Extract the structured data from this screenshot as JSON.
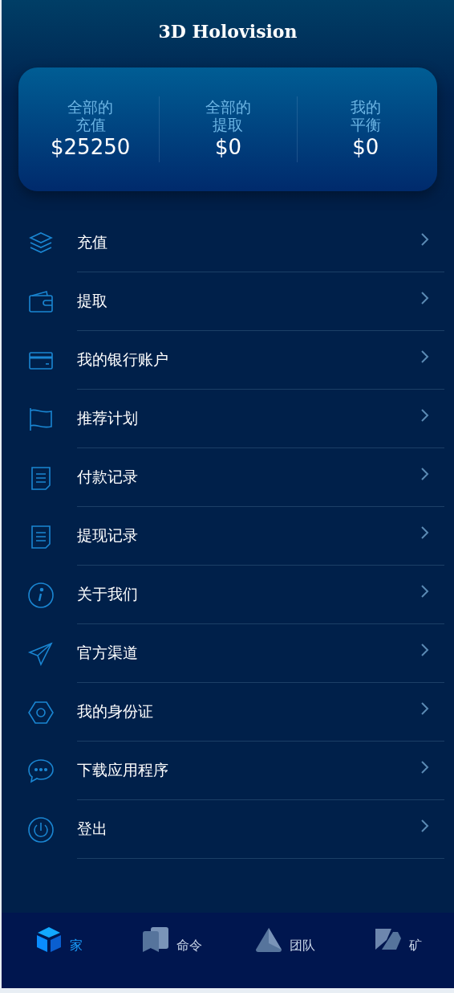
{
  "header": {
    "title": "3D Holovision"
  },
  "summary": [
    {
      "label_line1": "全部的",
      "label_line2": "充值",
      "value": "$25250"
    },
    {
      "label_line1": "全部的",
      "label_line2": "提取",
      "value": "$0"
    },
    {
      "label_line1": "我的",
      "label_line2": "平衡",
      "value": "$0"
    }
  ],
  "menu": [
    {
      "kind": "layers",
      "label": "充值"
    },
    {
      "kind": "wallet",
      "label": "提取"
    },
    {
      "kind": "card",
      "label": "我的银行账户"
    },
    {
      "kind": "flag",
      "label": "推荐计划"
    },
    {
      "kind": "document",
      "label": "付款记录"
    },
    {
      "kind": "document",
      "label": "提现记录"
    },
    {
      "kind": "info",
      "label": "关于我们"
    },
    {
      "kind": "send",
      "label": "官方渠道"
    },
    {
      "kind": "hexagon",
      "label": "我的身份证"
    },
    {
      "kind": "chat",
      "label": "下载应用程序"
    },
    {
      "kind": "power",
      "label": "登出"
    }
  ],
  "tab_bar": [
    {
      "kind": "home",
      "label": "家",
      "selected": true
    },
    {
      "kind": "orders",
      "label": "命令",
      "selected": false
    },
    {
      "kind": "team",
      "label": "团队",
      "selected": false
    },
    {
      "kind": "mine",
      "label": "矿",
      "selected": false
    }
  ]
}
